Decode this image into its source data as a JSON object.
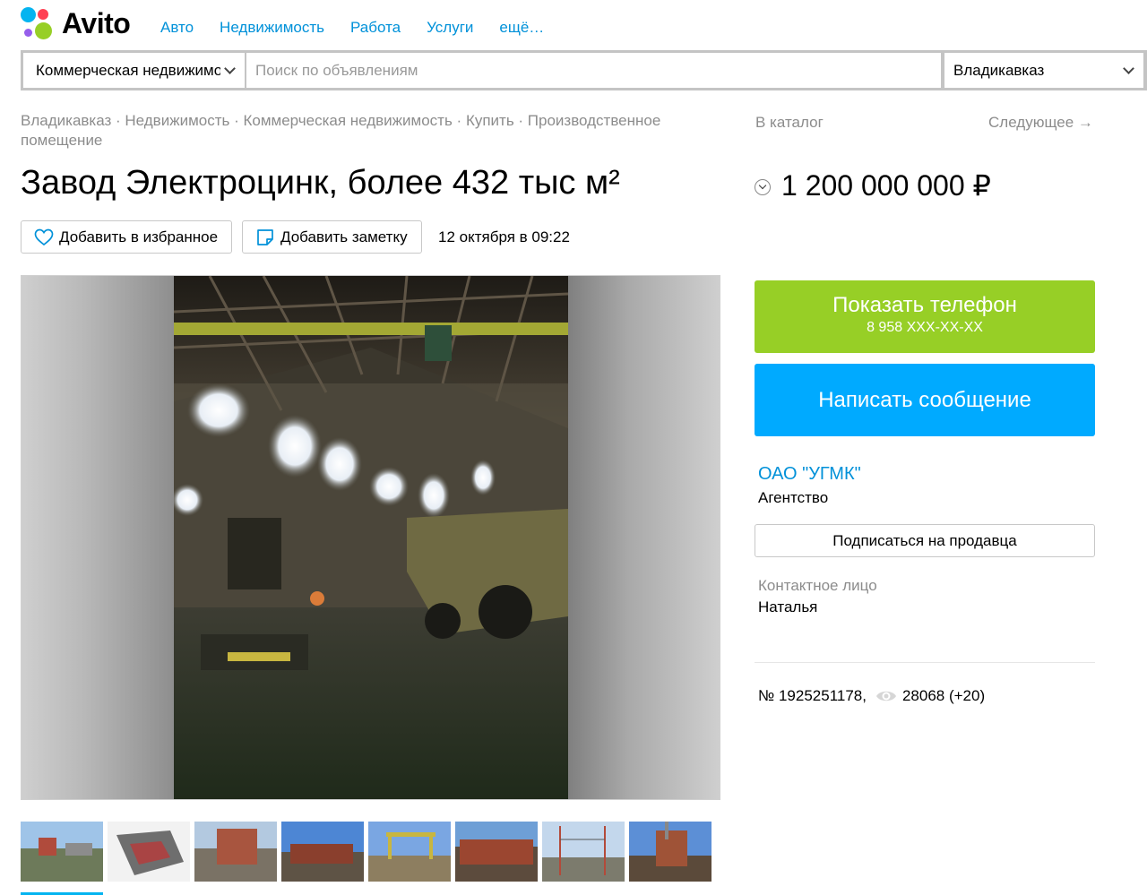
{
  "header": {
    "logo_text": "Avito",
    "nav": [
      "Авто",
      "Недвижимость",
      "Работа",
      "Услуги",
      "ещё…"
    ]
  },
  "search": {
    "category": "Коммерческая недвижимость",
    "placeholder": "Поиск по объявлениям",
    "value": "",
    "city": "Владикавказ"
  },
  "breadcrumbs": [
    "Владикавказ",
    "Недвижимость",
    "Коммерческая недвижимость",
    "Купить",
    "Производственное помещение"
  ],
  "to_catalog": "В каталог",
  "next_link": "Следующее →",
  "listing": {
    "title": "Завод Электроцинк, более 432 тыс м²",
    "price": "1 200 000 000 ₽",
    "favorite_label": "Добавить в избранное",
    "note_label": "Добавить заметку",
    "date": "12 октября в 09:22",
    "id_text": "№ 1925251178,",
    "views": "28068 (+20)"
  },
  "seller": {
    "show_phone": "Показать телефон",
    "phone_masked": "8 958 XXX-XX-XX",
    "write_message": "Написать сообщение",
    "name": "ОАО \"УГМК\"",
    "type": "Агентство",
    "subscribe": "Подписаться на продавца",
    "contact_label": "Контактное лицо",
    "contact_name": "Наталья"
  },
  "gallery": {
    "thumb_count": 8,
    "active_index": 0
  },
  "colors": {
    "link": "#0091d9",
    "green_button": "#97cf26",
    "blue_button": "#00aaff",
    "muted_text": "#8c8c8c"
  }
}
